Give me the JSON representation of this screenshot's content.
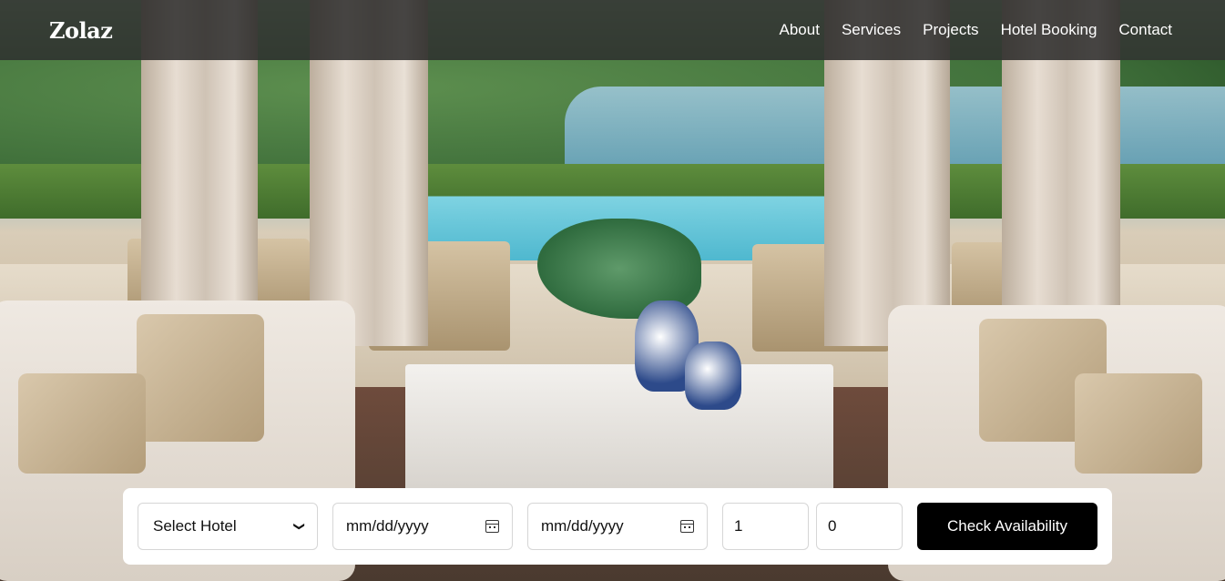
{
  "brand": {
    "logo_text": "Zolaz"
  },
  "nav": {
    "items": [
      {
        "label": "About"
      },
      {
        "label": "Services"
      },
      {
        "label": "Projects"
      },
      {
        "label": "Hotel Booking"
      },
      {
        "label": "Contact"
      }
    ]
  },
  "booking": {
    "hotel_select": {
      "selected": "Select Hotel"
    },
    "checkin": {
      "placeholder": "mm/dd/yyyy"
    },
    "checkout": {
      "placeholder": "mm/dd/yyyy"
    },
    "adults": {
      "value": "1"
    },
    "children": {
      "value": "0"
    },
    "submit_label": "Check Availability"
  },
  "icons": {
    "select_chevron": "chevron-down-icon",
    "date_picker": "calendar-icon"
  },
  "colors": {
    "nav_bg": "#222222",
    "button_bg": "#000000",
    "button_text": "#ffffff"
  }
}
